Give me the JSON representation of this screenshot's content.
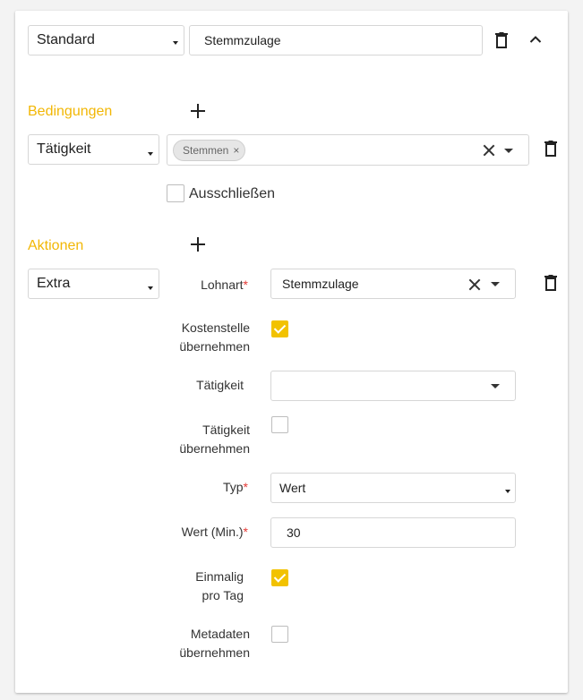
{
  "rule": {
    "type_select": "Standard",
    "name_value": "Stemmzulage"
  },
  "conditions": {
    "title": "Bedingungen",
    "field_select": "Tätigkeit",
    "chips": [
      "Stemmen"
    ],
    "chip_remove": "×",
    "exclude_label": "Ausschließen",
    "exclude_checked": false
  },
  "actions": {
    "title": "Aktionen",
    "action_select": "Extra",
    "lohnart": {
      "label": "Lohnart",
      "required": "*",
      "value": "Stemmzulage"
    },
    "kostenstelle": {
      "label_line1": "Kostenstelle",
      "label_line2": "übernehmen",
      "checked": true
    },
    "taetigkeit": {
      "label": "Tätigkeit",
      "value": ""
    },
    "taetigkeit_uebernehmen": {
      "label_line1": "Tätigkeit",
      "label_line2": "übernehmen",
      "checked": false
    },
    "typ": {
      "label": "Typ",
      "required": "*",
      "value": "Wert"
    },
    "wert": {
      "label": "Wert (Min.)",
      "required": "*",
      "value": "30"
    },
    "einmalig": {
      "label_line1": "Einmalig",
      "label_line2": "pro Tag",
      "checked": true
    },
    "metadaten": {
      "label_line1": "Metadaten",
      "label_line2": "übernehmen",
      "checked": false
    }
  },
  "colors": {
    "accent": "#f2b705",
    "checkbox_checked": "#f2c200",
    "required": "#e53935"
  }
}
